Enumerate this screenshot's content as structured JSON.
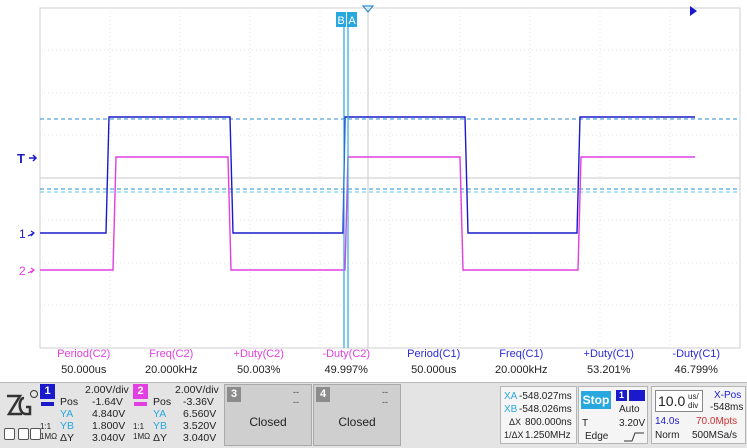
{
  "cursors": {
    "b_label": "B",
    "a_label": "A"
  },
  "markers": {
    "trigger_level": "T",
    "ch1_marker": "1",
    "ch2_marker": "2"
  },
  "measurements": {
    "labels": [
      "Period(C2)",
      "Freq(C2)",
      "+Duty(C2)",
      "-Duty(C2)",
      "Period(C1)",
      "Freq(C1)",
      "+Duty(C1)",
      "-Duty(C1)"
    ],
    "values": [
      "50.000us",
      "20.000kHz",
      "50.003%",
      "49.997%",
      "50.000us",
      "20.000kHz",
      "53.201%",
      "46.799%"
    ]
  },
  "ch1": {
    "num": "1",
    "scale": "2.00V/div",
    "pos_key": "Pos",
    "pos": "-1.64V",
    "ya_key": "YA",
    "ya": "4.840V",
    "yb_key": "YB",
    "yb": "1.800V",
    "dy_key": "ΔY",
    "dy": "3.040V",
    "coupling": "1:1",
    "impedance": "1MΩ"
  },
  "ch2": {
    "num": "2",
    "scale": "2.00V/div",
    "pos_key": "Pos",
    "pos": "-3.36V",
    "ya_key": "YA",
    "ya": "6.560V",
    "yb_key": "YB",
    "yb": "3.520V",
    "dy_key": "ΔY",
    "dy": "3.040V",
    "coupling": "1:1",
    "impedance": "1MΩ"
  },
  "ch3": {
    "num": "3",
    "dash1": "--",
    "dash2": "--",
    "label": "Closed"
  },
  "ch4": {
    "num": "4",
    "dash1": "--",
    "dash2": "--",
    "label": "Closed"
  },
  "cursor_readout": {
    "xa_key": "XA",
    "xa": "-548.027ms",
    "xb_key": "XB",
    "xb": "-548.026ms",
    "dx_key": "ΔX",
    "dx": "800.000ns",
    "inv_key": "1/ΔX",
    "inv": "1.250MHz"
  },
  "trigger": {
    "status": "Stop",
    "source": "1",
    "mode": "Auto",
    "type_key": "T",
    "level": "3.20V",
    "edge": "Edge"
  },
  "timebase": {
    "scale": "10.0",
    "unit_top": "us/",
    "unit_bottom": "div",
    "xpos_key": "X-Pos",
    "xpos": "-548ms",
    "time": "14.0s",
    "memory": "70.0Mpts",
    "mode": "Norm",
    "rate": "500MSa/s"
  },
  "colors": {
    "ch1": "#1a1acc",
    "ch2": "#e23ee2",
    "cursor": "#29a8e0",
    "ref_dash": "#2b8ed0"
  }
}
